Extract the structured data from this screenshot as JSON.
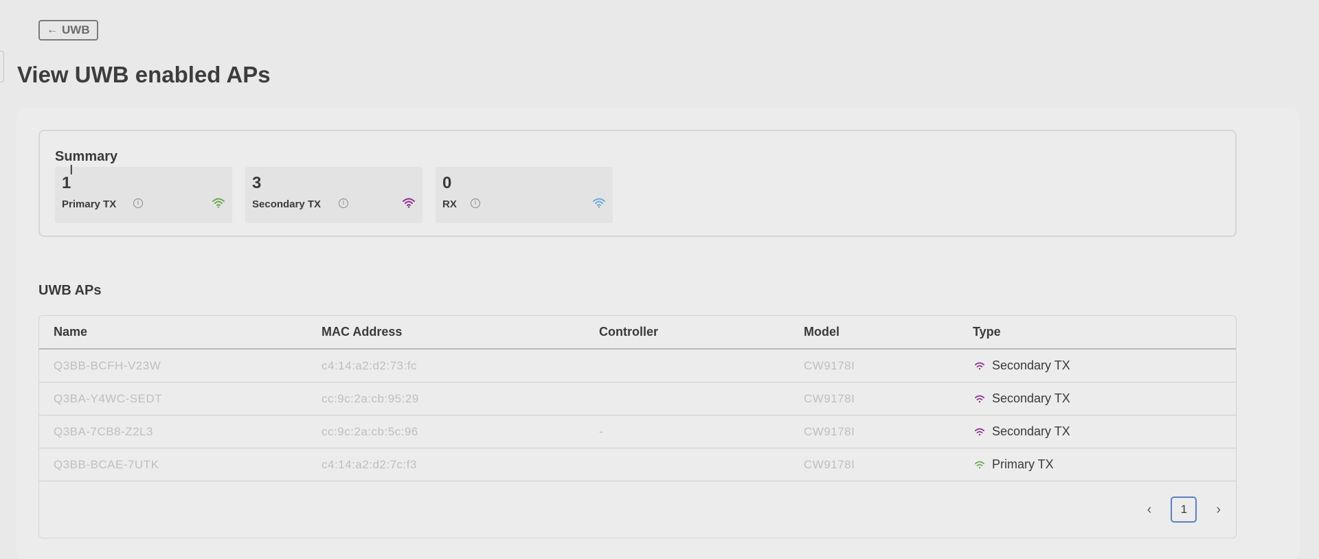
{
  "nav": {
    "back_label": "UWB"
  },
  "page": {
    "title": "View UWB enabled APs"
  },
  "summary": {
    "title": "Summary",
    "stats": [
      {
        "count": "1",
        "label": "Primary TX",
        "color": "#6aa84f"
      },
      {
        "count": "3",
        "label": "Secondary TX",
        "color": "#8e2b8e"
      },
      {
        "count": "0",
        "label": "RX",
        "color": "#6fa8dc"
      }
    ]
  },
  "table": {
    "title": "UWB APs",
    "headers": {
      "name": "Name",
      "mac": "MAC Address",
      "controller": "Controller",
      "model": "Model",
      "type": "Type"
    },
    "rows": [
      {
        "name": "Q3BB-BCFH-V23W",
        "mac": "c4:14:a2:d2:73:fc",
        "controller": "",
        "model": "CW9178I",
        "type": "Secondary TX",
        "type_color": "#8e2b8e"
      },
      {
        "name": "Q3BA-Y4WC-SEDT",
        "mac": "cc:9c:2a:cb:95:29",
        "controller": "",
        "model": "CW9178I",
        "type": "Secondary TX",
        "type_color": "#8e2b8e"
      },
      {
        "name": "Q3BA-7CB8-Z2L3",
        "mac": "cc:9c:2a:cb:5c:96",
        "controller": "-",
        "model": "CW9178I",
        "type": "Secondary TX",
        "type_color": "#8e2b8e"
      },
      {
        "name": "Q3BB-BCAE-7UTK",
        "mac": "c4:14:a2:d2:7c:f3",
        "controller": "",
        "model": "CW9178I",
        "type": "Primary TX",
        "type_color": "#6aa84f"
      }
    ]
  },
  "pagination": {
    "current_page": "1"
  }
}
